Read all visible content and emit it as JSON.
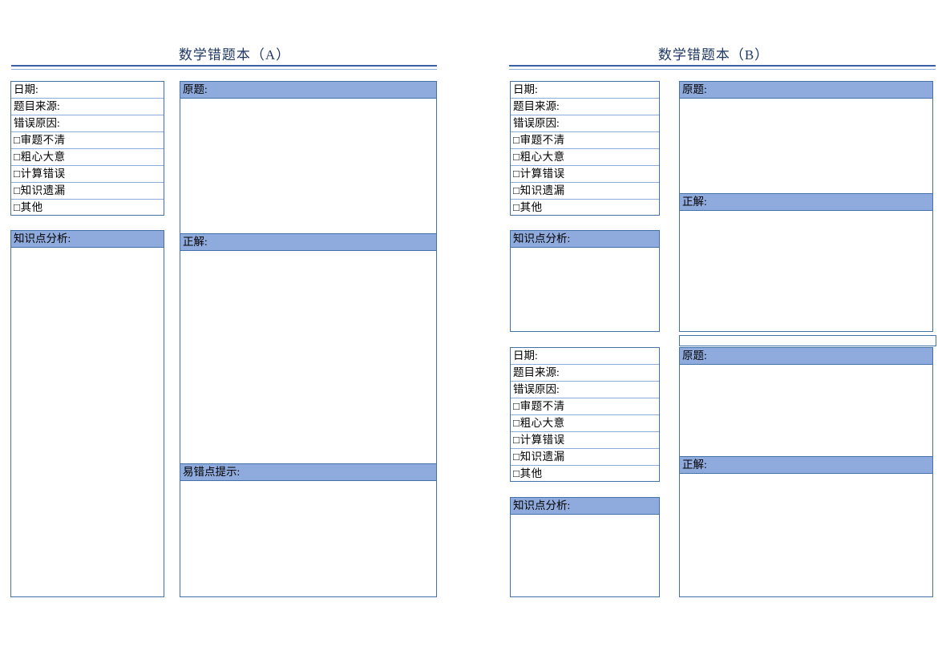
{
  "document": {
    "accent_dark": "#1F3864",
    "accent_rule": "#3A5FA8",
    "header_fill": "#8FAADC",
    "border_color": "#4472A8"
  },
  "labels": {
    "date": "日期:",
    "source": "题目来源:",
    "error_reason": "错误原因:",
    "checkbox_unclear": "□审题不清",
    "checkbox_careless": "□粗心大意",
    "checkbox_calc": "□计算错误",
    "checkbox_knowledge": "□知识遗漏",
    "checkbox_other": "□其他",
    "blank": "",
    "knowledge_analysis": "知识点分析:",
    "original_problem": "原题:",
    "correct_answer": "正解:",
    "pitfall_tip": "易错点提示:"
  },
  "pages": [
    {
      "id": "page-a",
      "title": "数学错题本（A）",
      "blocks": [
        {
          "id": "a-block-1",
          "info_rows": [
            "日期:",
            "题目来源:",
            "错误原因:",
            "□审题不清",
            "□粗心大意",
            "□计算错误",
            "□知识遗漏",
            "□其他",
            ""
          ],
          "analysis_header": "知识点分析:",
          "content_sections": [
            {
              "header": "原题:",
              "body": ""
            },
            {
              "header": "正解:",
              "body": ""
            },
            {
              "header": "易错点提示:",
              "body": ""
            }
          ]
        }
      ]
    },
    {
      "id": "page-b",
      "title": "数学错题本（B）",
      "blocks": [
        {
          "id": "b-block-1",
          "info_rows": [
            "日期:",
            "题目来源:",
            "错误原因:",
            "□审题不清",
            "□粗心大意",
            "□计算错误",
            "□知识遗漏",
            "□其他",
            ""
          ],
          "analysis_header": "知识点分析:",
          "content_sections": [
            {
              "header": "原题:",
              "body": ""
            },
            {
              "header": "正解:",
              "body": ""
            }
          ]
        },
        {
          "id": "b-block-2",
          "info_rows": [
            "日期:",
            "题目来源:",
            "错误原因:",
            "□审题不清",
            "□粗心大意",
            "□计算错误",
            "□知识遗漏",
            "□其他",
            ""
          ],
          "analysis_header": "知识点分析:",
          "content_sections": [
            {
              "header": "原题:",
              "body": ""
            },
            {
              "header": "正解:",
              "body": ""
            }
          ]
        }
      ],
      "spacer_row": ""
    }
  ]
}
